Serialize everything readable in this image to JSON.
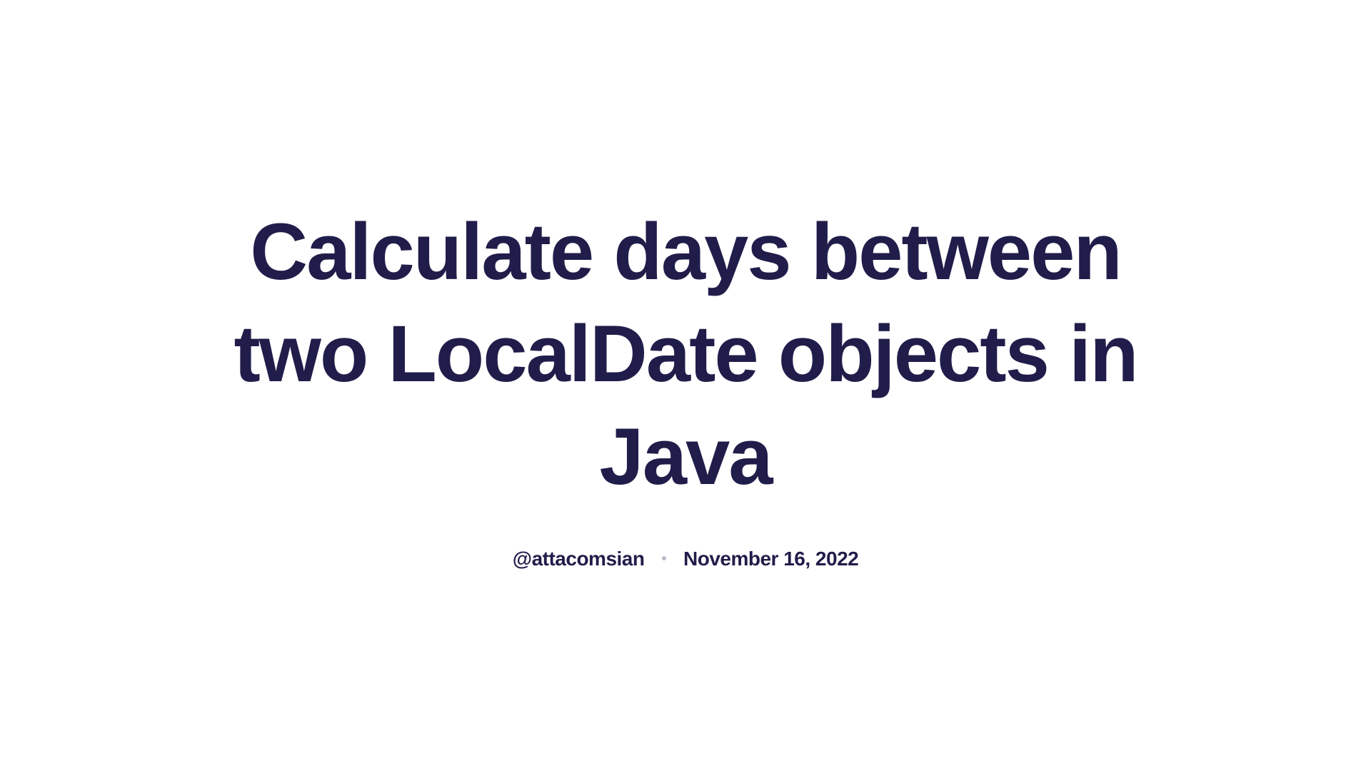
{
  "article": {
    "title": "Calculate days between two LocalDate objects in Java",
    "author": "@attacomsian",
    "date": "November 16, 2022"
  }
}
